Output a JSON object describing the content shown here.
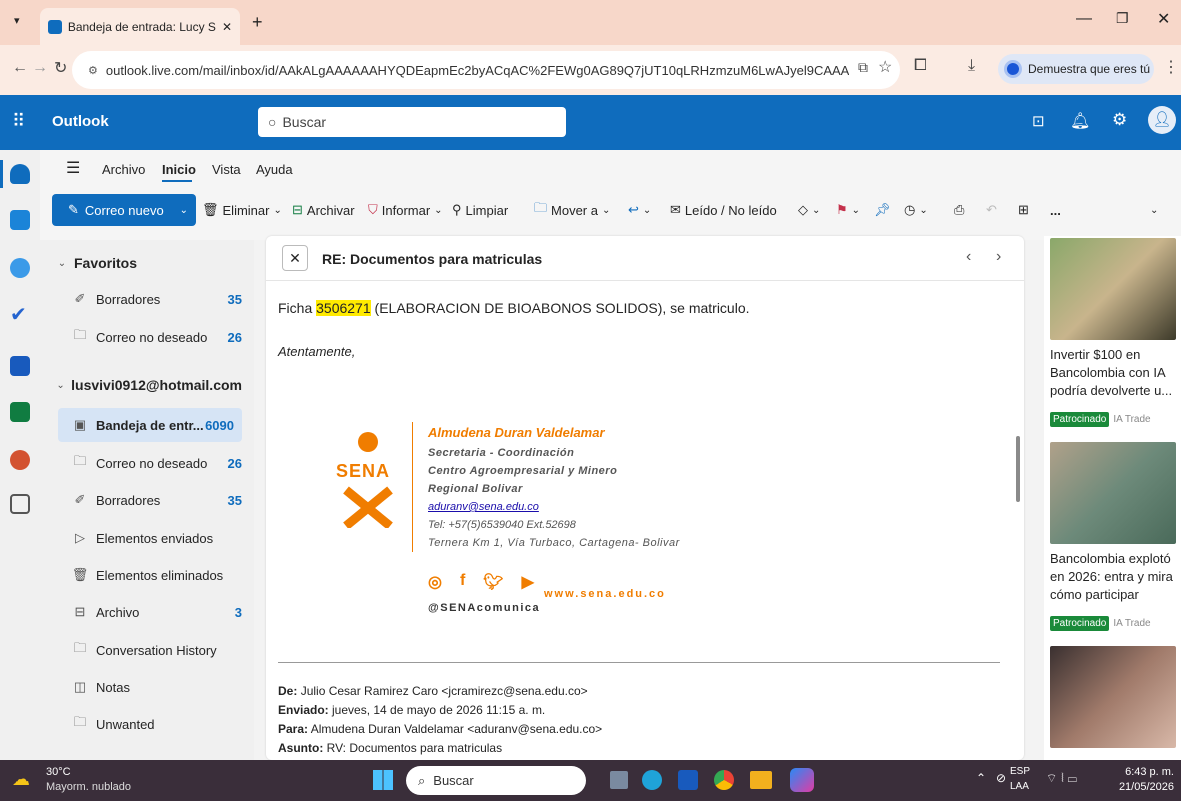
{
  "browser": {
    "tab_title": "Bandeja de entrada: Lucy Stella",
    "url": "outlook.live.com/mail/inbox/id/AAkALgAAAAAAHYQDEapmEc2byACqAC%2FEWg0AG89Q7jUT10qLRHzmzuM6LwAJyel9CAAA",
    "profile_label": "Demuestra que eres tú"
  },
  "header": {
    "app_name": "Outlook",
    "search_placeholder": "Buscar"
  },
  "ribbon": {
    "tabs": [
      "Archivo",
      "Inicio",
      "Vista",
      "Ayuda"
    ],
    "new_mail": "Correo nuevo",
    "delete": "Eliminar",
    "archive": "Archivar",
    "report": "Informar",
    "sweep": "Limpiar",
    "move": "Mover a",
    "read_unread": "Leído / No leído",
    "more": "..."
  },
  "folders": {
    "favorites_label": "Favoritos",
    "account": "lusvivi0912@hotmail.com",
    "items": [
      {
        "label": "Borradores",
        "count": "35"
      },
      {
        "label": "Correo no deseado",
        "count": "26"
      },
      {
        "label": "Bandeja de entr...",
        "count": "6090"
      },
      {
        "label": "Correo no deseado",
        "count": "26"
      },
      {
        "label": "Borradores",
        "count": "35"
      },
      {
        "label": "Elementos enviados",
        "count": ""
      },
      {
        "label": "Elementos eliminados",
        "count": ""
      },
      {
        "label": "Archivo",
        "count": "3"
      },
      {
        "label": "Conversation History",
        "count": ""
      },
      {
        "label": "Notas",
        "count": ""
      },
      {
        "label": "Unwanted",
        "count": ""
      }
    ]
  },
  "email": {
    "subject": "RE: Documentos para matriculas",
    "body_prefix": "Ficha ",
    "body_highlight": "3506271",
    "body_suffix": " (ELABORACION DE BIOABONOS SOLIDOS), se matriculo.",
    "closing": "Atentamente,",
    "signature": {
      "name": "Almudena Duran Valdelamar",
      "role": "Secretaria - Coordinación",
      "center": "Centro Agroempresarial y Minero",
      "regional": "Regional Bolivar",
      "email": "aduranv@sena.edu.co",
      "phone": "Tel: +57(5)6539040 Ext.52698",
      "address": "Ternera Km 1, Vía Turbaco, Cartagena- Bolivar",
      "logo_text": "SENA",
      "handle": "@SENAcomunica",
      "website": "www.sena.edu.co"
    },
    "quoted": {
      "from_label": "De:",
      "from": "Julio Cesar Ramirez Caro <jcramirezc@sena.edu.co>",
      "sent_label": "Enviado:",
      "sent": "jueves, 14 de mayo de 2026 11:15 a. m.",
      "to_label": "Para:",
      "to": "Almudena Duran Valdelamar <aduranv@sena.edu.co>",
      "subject_label": "Asunto:",
      "subject": "RV: Documentos para matriculas"
    }
  },
  "ads": [
    {
      "text": "Invertir $100 en Bancolombia con IA podría devolverte u...",
      "badge": "Patrocinado",
      "source": "IA Trade"
    },
    {
      "text": "Bancolombia explotó en 2026: entra y mira cómo participar",
      "badge": "Patrocinado",
      "source": "IA Trade"
    }
  ],
  "taskbar": {
    "weather_temp": "30°C",
    "weather_desc": "Mayorm. nublado",
    "search": "Buscar",
    "lang1": "ESP",
    "lang2": "LAA",
    "time": "6:43 p. m.",
    "date": "21/05/2026"
  },
  "colors": {
    "accent": "#0f6cbd",
    "sena_orange": "#f07d00",
    "highlight": "#ffea00",
    "sponsored": "#1a8a3a"
  }
}
